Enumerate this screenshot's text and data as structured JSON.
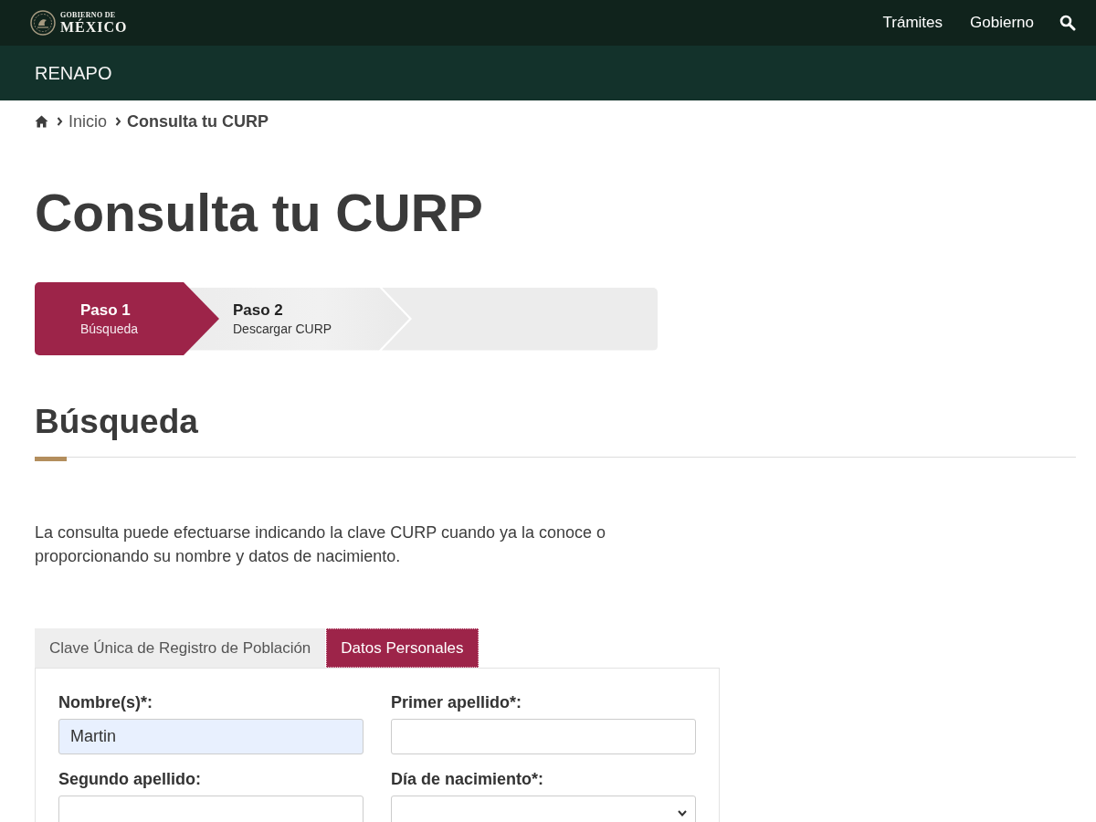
{
  "header": {
    "logo": {
      "line_1": "GOBIERNO DE",
      "line_2": "MÉXICO"
    },
    "nav": [
      {
        "label": "Trámites"
      },
      {
        "label": "Gobierno"
      }
    ]
  },
  "subheader": {
    "title": "RENAPO"
  },
  "breadcrumb": [
    {
      "label": "Inicio",
      "current": false
    },
    {
      "label": "Consulta tu CURP",
      "current": true
    }
  ],
  "page_title": "Consulta tu CURP",
  "steps": [
    {
      "title": "Paso 1",
      "subtitle": "Búsqueda",
      "selected": true
    },
    {
      "title": "Paso 2",
      "subtitle": "Descargar CURP",
      "selected": false
    }
  ],
  "section": {
    "title": "Búsqueda",
    "intro": "La consulta puede efectuarse indicando la clave CURP cuando ya la conoce o proporcionando su nombre y datos de nacimiento."
  },
  "tabs": [
    {
      "label": "Clave Única de Registro de Población",
      "selected": false
    },
    {
      "label": "Datos Personales",
      "selected": true
    }
  ],
  "form": {
    "fields": [
      {
        "kind": "text",
        "label": "Nombre(s)*:",
        "value": "Martin",
        "autofilled": true
      },
      {
        "kind": "text",
        "label": "Primer apellido*:",
        "autofilled": false
      },
      {
        "kind": "text",
        "label": "Segundo apellido:",
        "autofilled": false
      },
      {
        "kind": "select",
        "label": "Día de nacimiento*:"
      }
    ]
  }
}
